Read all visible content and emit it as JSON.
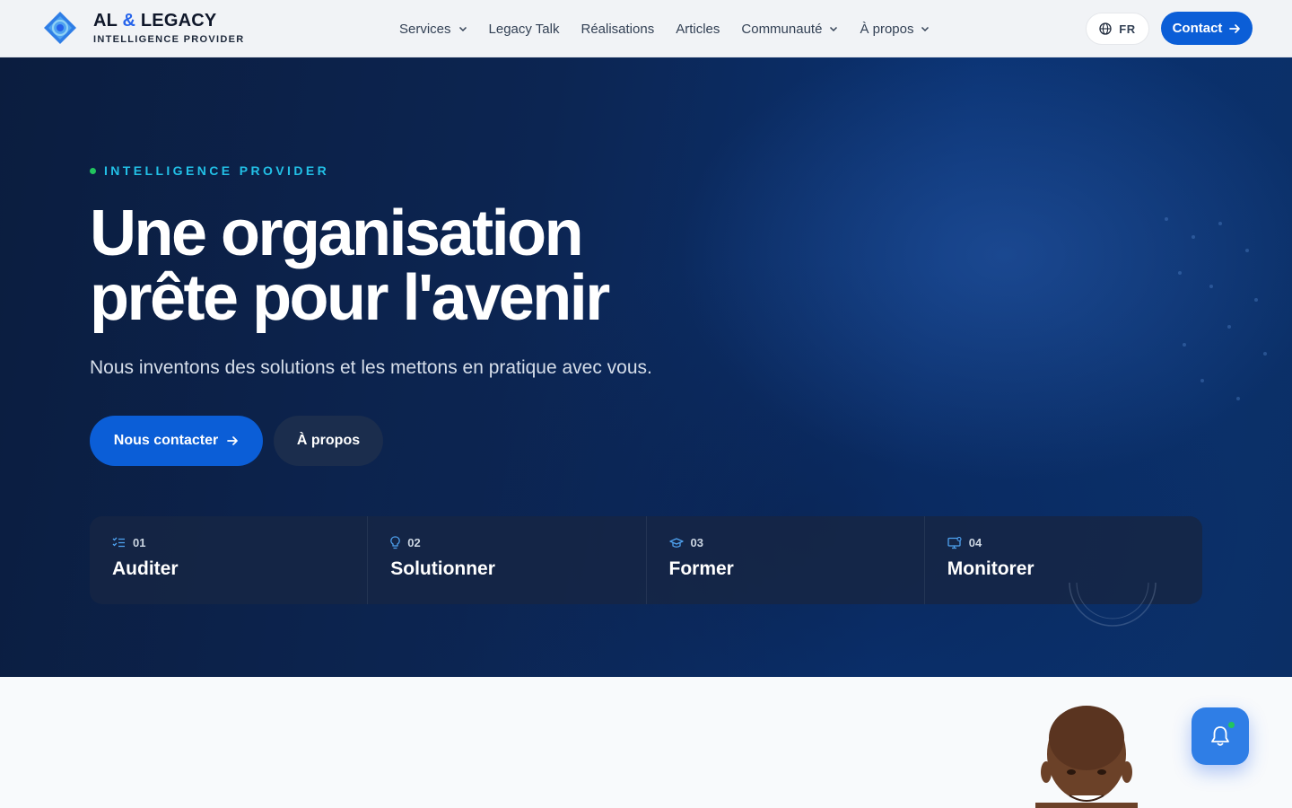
{
  "header": {
    "logo": {
      "title_main": "AL ",
      "title_amp": "&",
      "title_end": " LEGACY",
      "subtitle": "INTELLIGENCE PROVIDER"
    },
    "nav": [
      {
        "label": "Services",
        "has_dropdown": true
      },
      {
        "label": "Legacy Talk",
        "has_dropdown": false
      },
      {
        "label": "Réalisations",
        "has_dropdown": false
      },
      {
        "label": "Articles",
        "has_dropdown": false
      },
      {
        "label": "Communauté",
        "has_dropdown": true
      },
      {
        "label": "À propos",
        "has_dropdown": true
      }
    ],
    "lang": {
      "label": "FR",
      "icon": "globe-icon"
    },
    "contact": {
      "label": "Contact",
      "icon": "arrow-right-icon"
    }
  },
  "hero": {
    "eyebrow": "INTELLIGENCE PROVIDER",
    "title_line1": "Une organisation",
    "title_line2": "prête pour l'avenir",
    "subtitle": "Nous inventons des solutions et les mettons en pratique avec vous.",
    "primary_button": "Nous contacter",
    "secondary_button": "À propos",
    "steps": [
      {
        "num": "01",
        "title": "Auditer",
        "icon": "checklist-icon"
      },
      {
        "num": "02",
        "title": "Solutionner",
        "icon": "lightbulb-icon"
      },
      {
        "num": "03",
        "title": "Former",
        "icon": "graduation-cap-icon"
      },
      {
        "num": "04",
        "title": "Monitorer",
        "icon": "monitor-icon"
      }
    ]
  },
  "floating": {
    "notification_icon": "bell-icon"
  },
  "colors": {
    "accent": "#0b5ed7",
    "eyebrow": "#22c0e6",
    "status_dot": "#22c55e",
    "hero_bg": "#0c2552"
  }
}
